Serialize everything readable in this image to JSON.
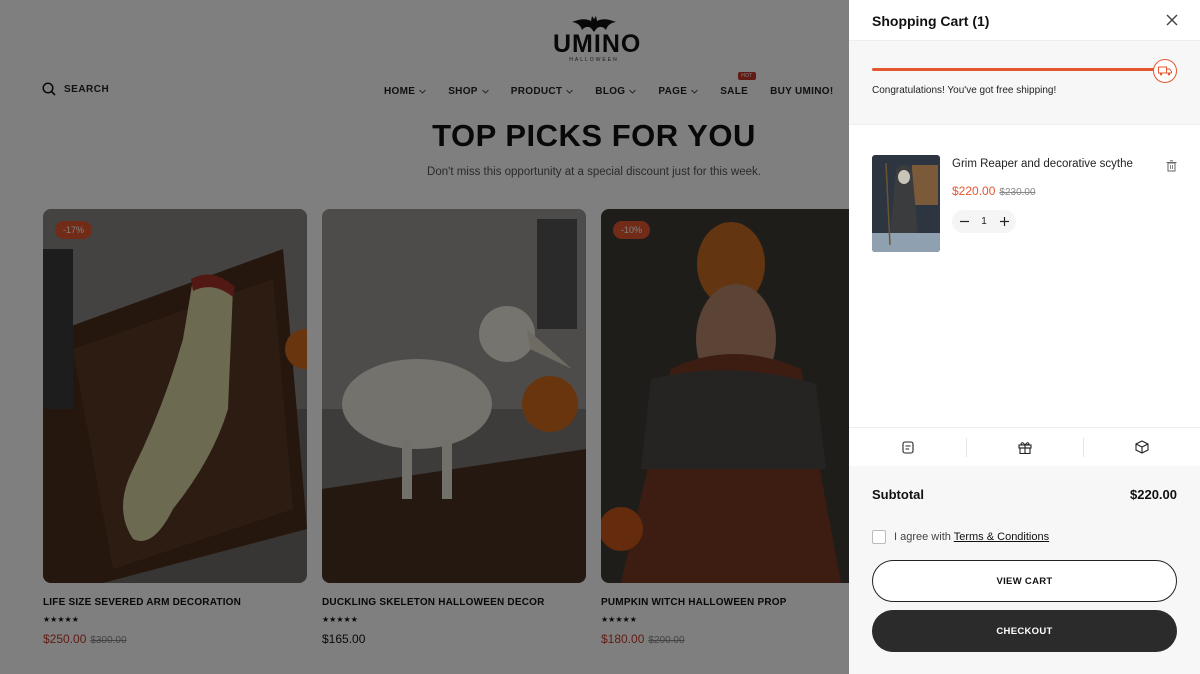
{
  "header": {
    "logo": {
      "name": "UMINO",
      "tagline": "HALLOWEEN"
    },
    "search_label": "SEARCH",
    "nav": [
      {
        "label": "HOME",
        "dropdown": true
      },
      {
        "label": "SHOP",
        "dropdown": true
      },
      {
        "label": "PRODUCT",
        "dropdown": true
      },
      {
        "label": "BLOG",
        "dropdown": true
      },
      {
        "label": "PAGE",
        "dropdown": true
      },
      {
        "label": "SALE",
        "dropdown": false,
        "badge": "HOT"
      },
      {
        "label": "BUY UMINO!",
        "dropdown": false
      }
    ]
  },
  "hero": {
    "title": "TOP PICKS FOR YOU",
    "subtitle": "Don't miss this opportunity at a special discount just for this week."
  },
  "products": [
    {
      "name": "LIFE SIZE SEVERED ARM DECORATION",
      "discount": "-17%",
      "rating": "★★★★★",
      "price": "$250.00",
      "old_price": "$300.00"
    },
    {
      "name": "DUCKLING SKELETON HALLOWEEN DECOR",
      "discount": "",
      "rating": "★★★★★",
      "price": "$165.00",
      "old_price": ""
    },
    {
      "name": "PUMPKIN WITCH HALLOWEEN PROP",
      "discount": "-10%",
      "rating": "★★★★★",
      "price": "$180.00",
      "old_price": "$200.00"
    }
  ],
  "cart": {
    "title": "Shopping Cart (1)",
    "shipping_progress": 1.0,
    "shipping_message": "Congratulations! You've got free shipping!",
    "items": [
      {
        "name": "Grim Reaper and decorative scythe",
        "price": "$220.00",
        "old_price": "$230.00",
        "quantity": "1"
      }
    ],
    "tools": [
      "note-icon",
      "gift-icon",
      "box-icon"
    ],
    "subtotal_label": "Subtotal",
    "subtotal_value": "$220.00",
    "agree_text": "I agree with",
    "terms_link": "Terms & Conditions",
    "view_cart_label": "VIEW CART",
    "checkout_label": "CHECKOUT"
  },
  "colors": {
    "accent": "#e4572e",
    "sale_price": "#c0392b",
    "dark_button": "#2b2b2b"
  }
}
